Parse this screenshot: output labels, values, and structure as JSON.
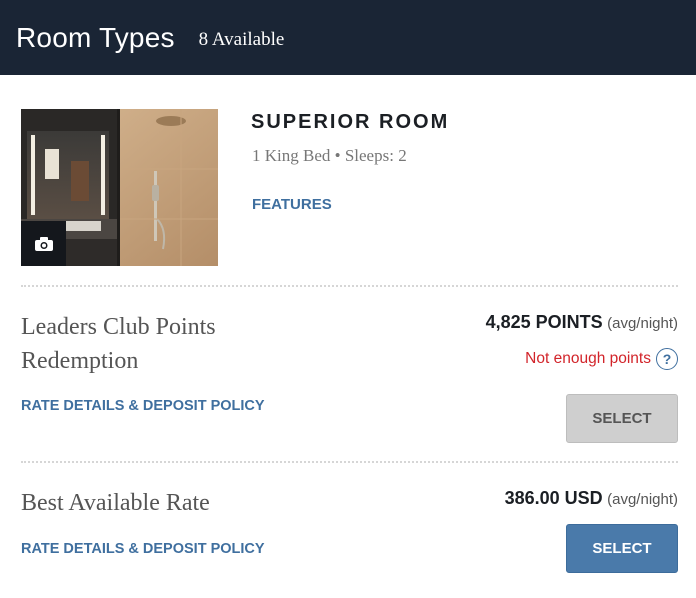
{
  "header": {
    "title": "Room Types",
    "available": "8 Available"
  },
  "room": {
    "name": "SUPERIOR ROOM",
    "details": "1 King Bed • Sleeps: 2",
    "features_link": "FEATURES",
    "photo_icon": "camera-icon"
  },
  "rates": [
    {
      "name_line1": "Leaders Club Points",
      "name_line2": "Redemption",
      "amount": "4,825 POINTS",
      "unit": "(avg/night)",
      "warning": "Not enough points",
      "help_glyph": "?",
      "details_link": "RATE DETAILS & DEPOSIT POLICY",
      "select_label": "SELECT",
      "select_enabled": false
    },
    {
      "name_line1": "Best Available Rate",
      "amount": "386.00 USD",
      "unit": "(avg/night)",
      "details_link": "RATE DETAILS & DEPOSIT POLICY",
      "select_label": "SELECT",
      "select_enabled": true
    }
  ],
  "colors": {
    "header_bg": "#1a2535",
    "link": "#3f6f9f",
    "warning": "#d2242a",
    "button_active": "#4a7aaa",
    "button_disabled": "#cfcfcf"
  }
}
